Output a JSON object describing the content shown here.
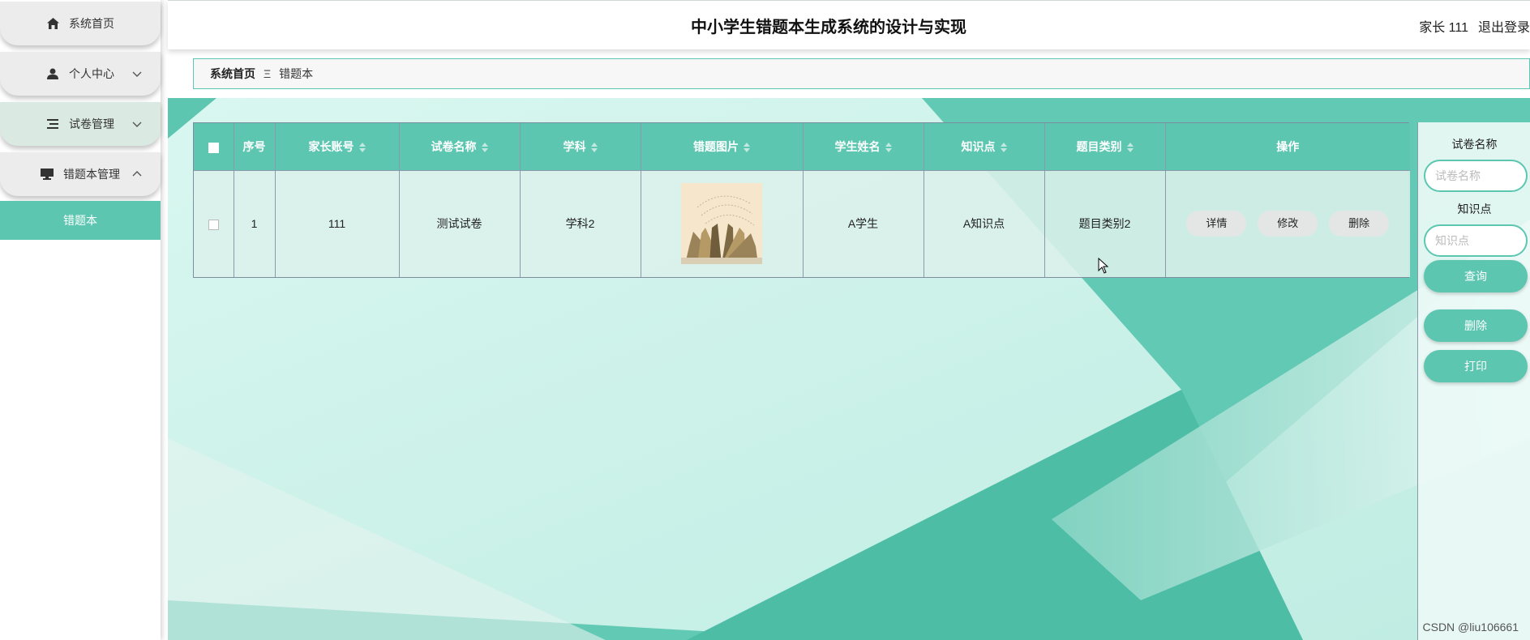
{
  "app": {
    "title": "中小学生错题本生成系统的设计与实现",
    "user_label": "家长 111",
    "logout": "退出登录"
  },
  "sidebar": {
    "items": [
      {
        "label": "系统首页",
        "icon": "home-icon"
      },
      {
        "label": "个人中心",
        "icon": "user-icon"
      },
      {
        "label": "试卷管理",
        "icon": "list-icon"
      },
      {
        "label": "错题本管理",
        "icon": "monitor-icon"
      }
    ],
    "submenu": {
      "label": "错题本"
    }
  },
  "breadcrumb": {
    "home": "系统首页",
    "separator": "Ξ",
    "current": "错题本"
  },
  "table": {
    "headers": [
      "序号",
      "家长账号",
      "试卷名称",
      "学科",
      "错题图片",
      "学生姓名",
      "知识点",
      "题目类别",
      "操作"
    ],
    "rows": [
      {
        "index": "1",
        "parent_account": "111",
        "paper_name": "测试试卷",
        "subject": "学科2",
        "image": "open-book-image",
        "student_name": "A学生",
        "knowledge_point": "A知识点",
        "question_category": "题目类别2",
        "actions": [
          "详情",
          "修改",
          "删除"
        ]
      }
    ]
  },
  "filters": {
    "paper_name_label": "试卷名称",
    "paper_name_placeholder": "试卷名称",
    "knowledge_label": "知识点",
    "knowledge_placeholder": "知识点",
    "query_button": "查询",
    "delete_button": "删除",
    "print_button": "打印"
  },
  "watermark": "CSDN @liu106661",
  "colors": {
    "accent": "#5cc6b1",
    "background": "#c8f1e8"
  }
}
